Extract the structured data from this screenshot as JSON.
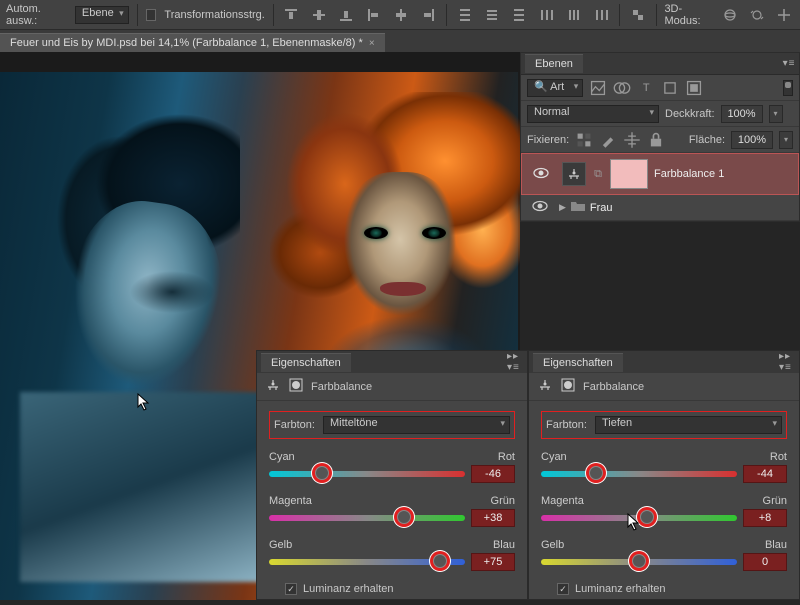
{
  "options": {
    "auto_select_label": "Autom. ausw.:",
    "auto_select_value": "Ebene",
    "transform_controls_label": "Transformationsstrg.",
    "mode3d_label": "3D-Modus:"
  },
  "tab": {
    "title": "Feuer und Eis by MDI.psd bei 14,1% (Farbbalance 1, Ebenenmaske/8) *"
  },
  "layers_panel": {
    "tab_label": "Ebenen",
    "filter_label": "Art",
    "blend_mode": "Normal",
    "opacity_label": "Deckkraft:",
    "opacity_value": "100%",
    "lock_label": "Fixieren:",
    "fill_label": "Fläche:",
    "fill_value": "100%",
    "layers": [
      {
        "name": "Farbbalance 1",
        "type": "adjustment",
        "selected": true
      },
      {
        "name": "Frau",
        "type": "group",
        "selected": false
      }
    ]
  },
  "properties_left": {
    "tab_label": "Eigenschaften",
    "title": "Farbbalance",
    "tone_label": "Farbton:",
    "tone_value": "Mitteltöne",
    "sliders": [
      {
        "left": "Cyan",
        "right": "Rot",
        "value": "-46",
        "pos": 27,
        "track": "track-cr",
        "highlight": true
      },
      {
        "left": "Magenta",
        "right": "Grün",
        "value": "+38",
        "pos": 69,
        "track": "track-mg",
        "highlight": true
      },
      {
        "left": "Gelb",
        "right": "Blau",
        "value": "+75",
        "pos": 87,
        "track": "track-yb",
        "highlight": true
      }
    ],
    "luminance_label": "Luminanz erhalten",
    "luminance_checked": true
  },
  "properties_right": {
    "tab_label": "Eigenschaften",
    "title": "Farbbalance",
    "tone_label": "Farbton:",
    "tone_value": "Tiefen",
    "sliders": [
      {
        "left": "Cyan",
        "right": "Rot",
        "value": "-44",
        "pos": 28,
        "track": "track-cr",
        "highlight": true
      },
      {
        "left": "Magenta",
        "right": "Grün",
        "value": "+8",
        "pos": 54,
        "track": "track-mg",
        "highlight": true
      },
      {
        "left": "Gelb",
        "right": "Blau",
        "value": "0",
        "pos": 50,
        "track": "track-yb",
        "highlight": true
      }
    ],
    "luminance_label": "Luminanz erhalten",
    "luminance_checked": true
  }
}
